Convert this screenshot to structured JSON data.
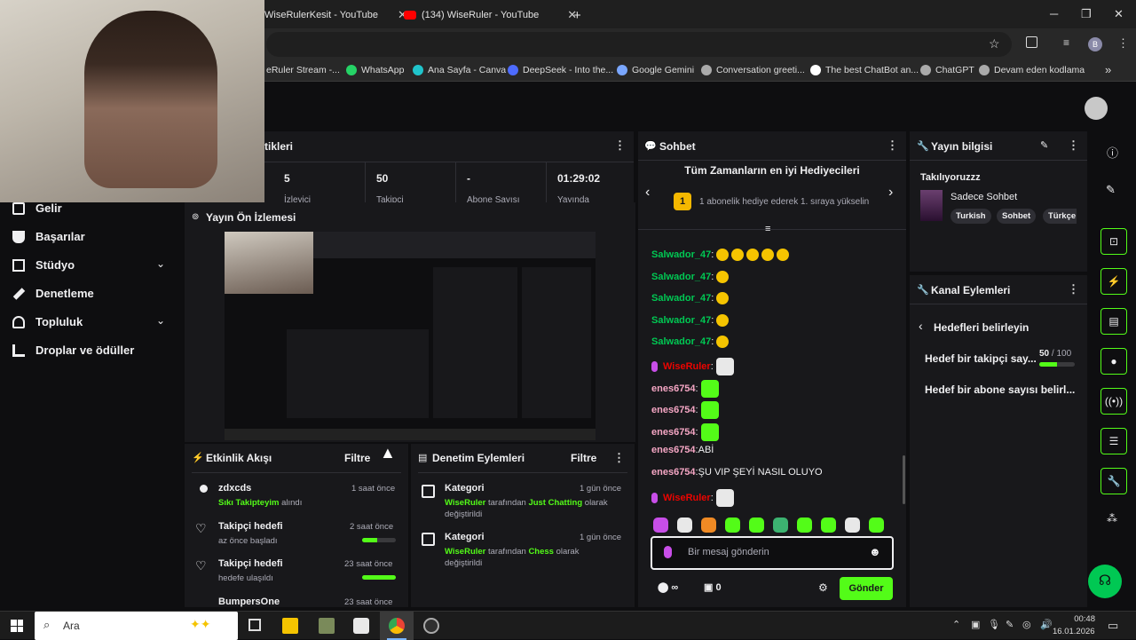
{
  "browser": {
    "tabs": [
      {
        "label": "WiseRulerKesit - YouTube"
      },
      {
        "label": "(134) WiseRuler - YouTube"
      }
    ],
    "new_tab": "+",
    "window_controls": {
      "minimize": "─",
      "maximize": "❐",
      "close": "✕"
    },
    "profile_initial": "B",
    "bookmarks": [
      "eRuler Stream -...",
      "WhatsApp",
      "Ana Sayfa - Canva",
      "DeepSeek - Into the...",
      "Google Gemini",
      "Conversation greeti...",
      "The best ChatBot an...",
      "ChatGPT",
      "Devam eden kodlama"
    ],
    "bookmarks_more": "»"
  },
  "sidebar": {
    "items": [
      {
        "label": "Gelir",
        "icon": "chart-icon",
        "expand": ""
      },
      {
        "label": "Başarılar",
        "icon": "trophy-icon",
        "expand": ""
      },
      {
        "label": "Stüdyo",
        "icon": "studio-icon",
        "expand": "⌄"
      },
      {
        "label": "Denetleme",
        "icon": "wrench-icon",
        "expand": ""
      },
      {
        "label": "Topluluk",
        "icon": "people-icon",
        "expand": "⌄"
      },
      {
        "label": "Droplar ve ödüller",
        "icon": "drops-icon",
        "expand": ""
      }
    ]
  },
  "stats": {
    "title": "tikleri",
    "values": [
      {
        "value": "5",
        "label": "İzleyici"
      },
      {
        "value": "50",
        "label": "Takipçi"
      },
      {
        "value": "-",
        "label": "Abone Sayısı"
      },
      {
        "value": "01:29:02",
        "label": "Yayında"
      }
    ]
  },
  "preview": {
    "title": "Yayın Ön İzlemesi"
  },
  "activity": {
    "title": "Etkinlik Akışı",
    "filter": "Filtre",
    "items": [
      {
        "title": "zdxcds",
        "sub_highlight": "Sıkı Takipteyim",
        "sub_rest": " alındı",
        "time": "1 saat önce",
        "progress": null
      },
      {
        "title": "Takipçi hedefi",
        "sub_highlight": "",
        "sub_rest": "az önce başladı",
        "time": "2 saat önce",
        "progress": 0.45
      },
      {
        "title": "Takipçi hedefi",
        "sub_highlight": "",
        "sub_rest": "hedefe ulaşıldı",
        "time": "23 saat önce",
        "progress": 1.0
      },
      {
        "title": "BumpersOne",
        "sub_highlight": "",
        "sub_rest": "",
        "time": "23 saat önce",
        "progress": null
      }
    ]
  },
  "moderation": {
    "title": "Denetim Eylemleri",
    "filter": "Filtre",
    "items": [
      {
        "title": "Kategori",
        "user": "WiseRuler",
        "mid": " tarafından ",
        "category": "Just Chatting",
        "end": " olarak",
        "line2": "değiştirildi",
        "time": "1 gün önce"
      },
      {
        "title": "Kategori",
        "user": "WiseRuler",
        "mid": " tarafından ",
        "category": "Chess",
        "end": " olarak",
        "line2": "değiştirildi",
        "time": "1 gün önce"
      }
    ]
  },
  "chat": {
    "title": "Sohbet",
    "leaderboard_title": "Tüm Zamanların en iyi Hediyecileri",
    "rank": "1",
    "leaderboard_text": "1 abonelik hediye ederek 1. sıraya yükselin",
    "messages": [
      {
        "user": "Salwador_47",
        "text": "",
        "emotes": 5,
        "color": "g",
        "mod": false
      },
      {
        "user": "Salwador_47",
        "text": "",
        "emotes": 1,
        "color": "g",
        "mod": false
      },
      {
        "user": "Salwador_47",
        "text": "",
        "emotes": 1,
        "color": "g",
        "mod": false
      },
      {
        "user": "Salwador_47",
        "text": "",
        "emotes": 1,
        "color": "g",
        "mod": false
      },
      {
        "user": "Salwador_47",
        "text": "",
        "emotes": 1,
        "color": "g",
        "mod": false
      },
      {
        "user": "WiseRuler",
        "text": "",
        "emotes": 1,
        "color": "r",
        "mod": true
      },
      {
        "user": "enes6754",
        "text": "",
        "emotes": 1,
        "color": "p",
        "mod": false
      },
      {
        "user": "enes6754",
        "text": "",
        "emotes": 1,
        "color": "p",
        "mod": false
      },
      {
        "user": "enes6754",
        "text": "",
        "emotes": 1,
        "color": "p",
        "mod": false
      },
      {
        "user": "enes6754",
        "text": "ABİ",
        "emotes": 0,
        "color": "p",
        "mod": false
      },
      {
        "user": "enes6754",
        "text": "ŞU VIP ŞEYİ NASIL OLUYO",
        "emotes": 0,
        "color": "p",
        "mod": false
      },
      {
        "user": "WiseRuler",
        "text": "",
        "emotes": 1,
        "color": "r",
        "mod": true
      }
    ],
    "input_placeholder": "Bir mesaj gönderin",
    "infinity": "∞",
    "gift_count": "0",
    "send_label": "Gönder"
  },
  "stream_info": {
    "title": "Yayın bilgisi",
    "stream_title": "Takılıyoruzzz",
    "category": "Sadece Sohbet",
    "tags": [
      "Turkish",
      "Sohbet",
      "Türkçe"
    ]
  },
  "channel_actions": {
    "title": "Kanal Eylemleri",
    "back_title": "Hedefleri belirleyin",
    "goal1": "Hedef bir takipçi say...",
    "goal1_current": "50",
    "goal1_sep": " / ",
    "goal1_target": "100",
    "goal1_progress": 0.5,
    "goal2": "Hedef bir abone sayısı belirl..."
  },
  "taskbar": {
    "search_placeholder": "Ara",
    "time": "00:48",
    "date": "16.01.2026"
  },
  "colors": {
    "accent": "#53fc18",
    "panel": "#18181b",
    "bg": "#0e0e10"
  }
}
